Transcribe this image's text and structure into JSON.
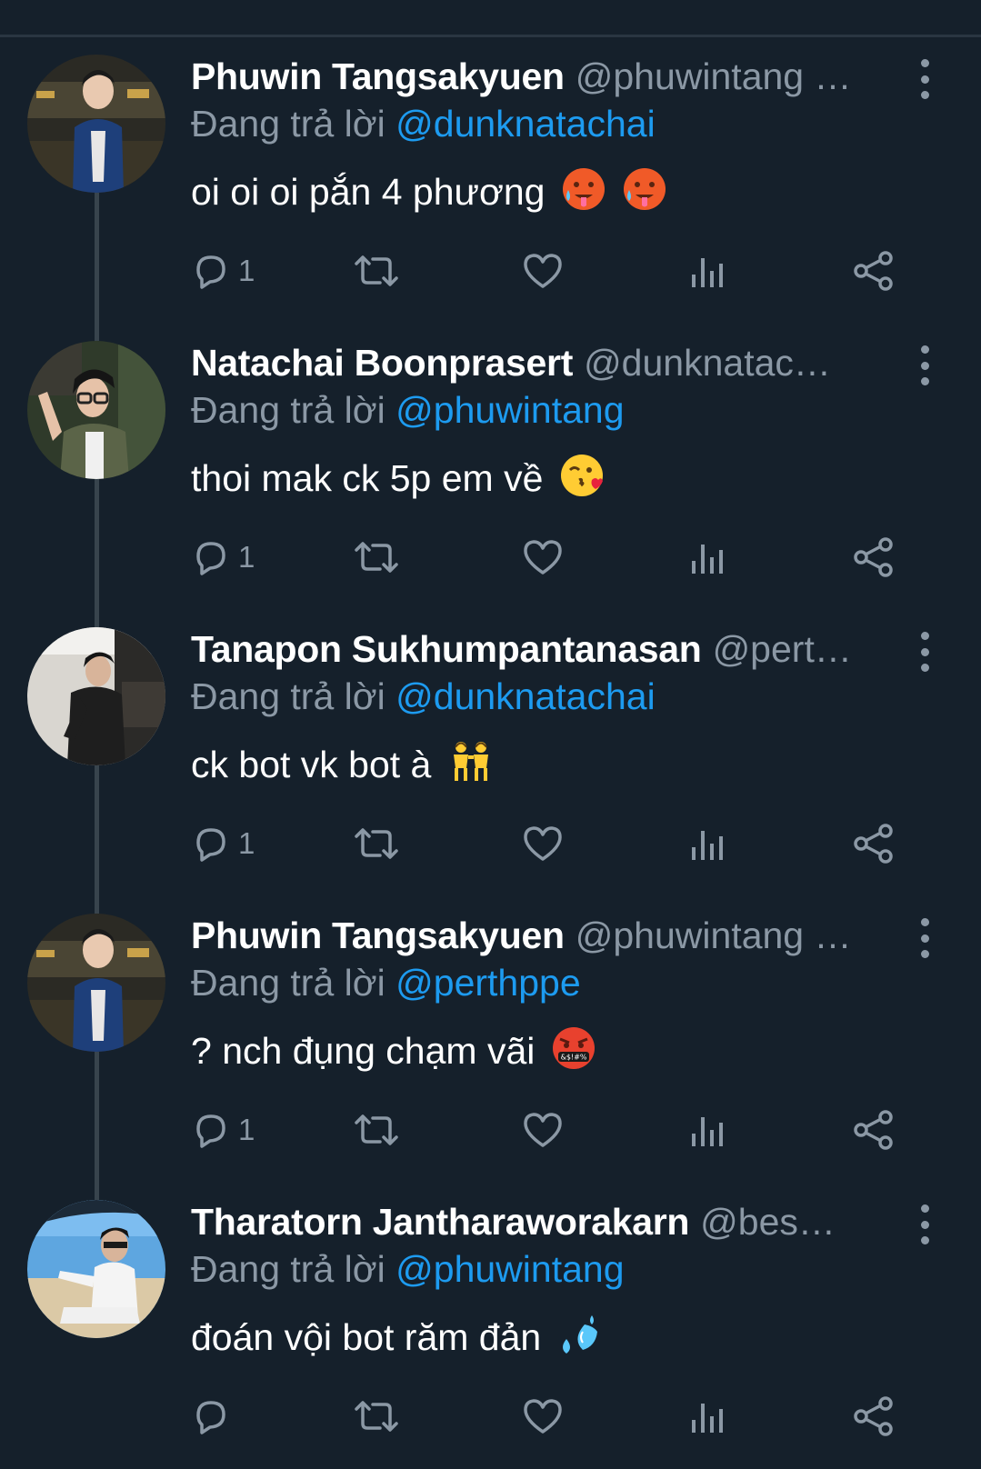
{
  "tweets": [
    {
      "display_name": "Phuwin Tangsakyuen",
      "handle": "@phuwintang …",
      "replying_label": "Đang trả lời",
      "replying_to": "@dunknatachai",
      "text": "oi oi oi pắn 4 phương",
      "emoji": [
        "hot-face-emoji",
        "hot-face-emoji"
      ],
      "reply_count": "1",
      "avatar": "avatar-phuwin"
    },
    {
      "display_name": "Natachai Boonprasert",
      "handle": "@dunknatac…",
      "replying_label": "Đang trả lời",
      "replying_to": "@phuwintang",
      "text": "thoi mak ck 5p em về",
      "emoji": [
        "kissing-heart-emoji"
      ],
      "reply_count": "1",
      "avatar": "avatar-natachai"
    },
    {
      "display_name": "Tanapon Sukhumpantanasan",
      "handle": "@pert…",
      "replying_label": "Đang trả lời",
      "replying_to": "@dunknatachai",
      "text": "ck bot vk bot à",
      "emoji": [
        "two-women-emoji"
      ],
      "reply_count": "1",
      "avatar": "avatar-tanapon"
    },
    {
      "display_name": "Phuwin Tangsakyuen",
      "handle": "@phuwintang …",
      "replying_label": "Đang trả lời",
      "replying_to": "@perthppe",
      "text": "? nch đụng chạm vãi",
      "emoji": [
        "cursing-face-emoji"
      ],
      "reply_count": "1",
      "avatar": "avatar-phuwin"
    },
    {
      "display_name": "Tharatorn Jantharaworakarn",
      "handle": "@bes…",
      "replying_label": "Đang trả lời",
      "replying_to": "@phuwintang",
      "text": "đoán vội bot răm đản",
      "emoji": [
        "sweat-droplets-emoji"
      ],
      "reply_count": "",
      "avatar": "avatar-tharatorn"
    }
  ],
  "cursing_face_glyph": "&$!#%",
  "colors": {
    "background": "#15202b",
    "name": "#ffffff",
    "secondary": "#8b98a5",
    "mention": "#1d9bf0",
    "thread_line": "#38444d"
  }
}
